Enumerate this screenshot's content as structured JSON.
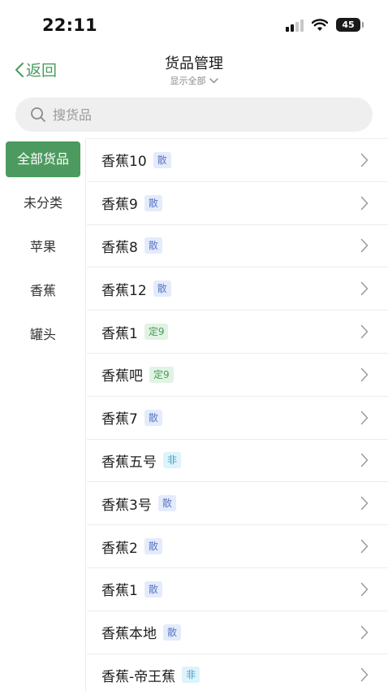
{
  "status_bar": {
    "time": "22:11",
    "battery": "45"
  },
  "nav": {
    "back_label": "返回",
    "title": "货品管理",
    "subtitle": "显示全部"
  },
  "search": {
    "placeholder": "搜货品"
  },
  "categories": [
    {
      "label": "全部货品",
      "active": true
    },
    {
      "label": "未分类",
      "active": false
    },
    {
      "label": "苹果",
      "active": false
    },
    {
      "label": "香蕉",
      "active": false
    },
    {
      "label": "罐头",
      "active": false
    }
  ],
  "products": [
    {
      "name": "香蕉10",
      "tag": "散",
      "tag_style": "blue"
    },
    {
      "name": "香蕉9",
      "tag": "散",
      "tag_style": "blue"
    },
    {
      "name": "香蕉8",
      "tag": "散",
      "tag_style": "blue"
    },
    {
      "name": "香蕉12",
      "tag": "散",
      "tag_style": "blue"
    },
    {
      "name": "香蕉1",
      "tag": "定9",
      "tag_style": "green"
    },
    {
      "name": "香蕉吧",
      "tag": "定9",
      "tag_style": "green"
    },
    {
      "name": "香蕉7",
      "tag": "散",
      "tag_style": "blue"
    },
    {
      "name": "香蕉五号",
      "tag": "非",
      "tag_style": "cyan"
    },
    {
      "name": "香蕉3号",
      "tag": "散",
      "tag_style": "blue"
    },
    {
      "name": "香蕉2",
      "tag": "散",
      "tag_style": "blue"
    },
    {
      "name": "香蕉1",
      "tag": "散",
      "tag_style": "blue"
    },
    {
      "name": "香蕉本地",
      "tag": "散",
      "tag_style": "blue"
    },
    {
      "name": "香蕉-帝王蕉",
      "tag": "非",
      "tag_style": "cyan"
    }
  ],
  "colors": {
    "accent": "#4c9a5f",
    "tag_blue": "#5b79c7",
    "tag_green": "#4b9a5a",
    "tag_cyan": "#3da0c9"
  },
  "icons": {
    "back": "chevron-left-icon",
    "dropdown": "chevron-down-icon",
    "search": "search-icon",
    "row": "chevron-right-icon"
  }
}
